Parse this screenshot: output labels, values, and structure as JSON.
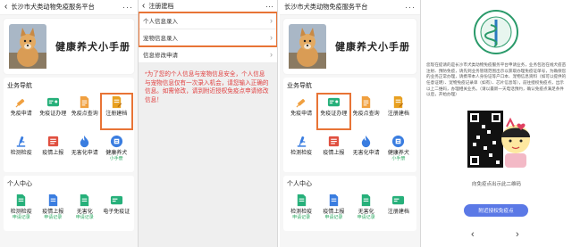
{
  "panel1": {
    "title": "长沙市犬类动物免疫服务平台",
    "hero_title": "健康养犬小手册",
    "business_nav": "业务导航",
    "items": [
      {
        "label": "免疫申请",
        "icon": "syringe-icon",
        "color": "#f0a040"
      },
      {
        "label": "免疫证办理",
        "icon": "id-card-icon",
        "color": "#26b07a"
      },
      {
        "label": "免疫点查询",
        "icon": "document-icon",
        "color": "#f0a040"
      },
      {
        "label": "注册建档",
        "icon": "edit-doc-icon",
        "color": "#e8a020"
      },
      {
        "label": "检测检疫",
        "icon": "microscope-icon",
        "color": "#3a7de0"
      },
      {
        "label": "疫情上报",
        "icon": "report-icon",
        "color": "#e05040"
      },
      {
        "label": "无害化申请",
        "icon": "flame-icon",
        "color": "#3a7de0"
      },
      {
        "label": "健康养犬",
        "sub": "小手册",
        "icon": "book-icon",
        "color": "#3a7de0"
      }
    ],
    "personal_center": "个人中心",
    "personal_items": [
      {
        "label": "检测检疫",
        "sub": "申请记录",
        "icon": "doc-blue-icon",
        "color": "#26b07a"
      },
      {
        "label": "疫情上报",
        "sub": "申请记录",
        "icon": "doc-blue-icon",
        "color": "#3a7de0"
      },
      {
        "label": "无害化",
        "sub": "申请记录",
        "icon": "doc-green-icon",
        "color": "#26b07a"
      },
      {
        "label": "电子免疫证",
        "icon": "card-icon",
        "color": "#26b07a"
      }
    ]
  },
  "panel2": {
    "title": "注册建档",
    "items": [
      "个人信息录入",
      "宠物信息录入",
      "信息修改申请"
    ],
    "notice": "*为了您的个人信息与宠物信息安全，个人信息与宠物信息仅有一次录入机会，请您输入正确的信息。如需修改，请到附近授权免疫点申请修改信息！"
  },
  "panel3": {
    "title": "长沙市犬类动物免疫服务平台",
    "hero_title": "健康养犬小手册",
    "business_nav": "业务导航",
    "items": [
      {
        "label": "免疫申请",
        "icon": "syringe-icon",
        "color": "#f0a040"
      },
      {
        "label": "免疫证办理",
        "icon": "id-card-icon",
        "color": "#26b07a"
      },
      {
        "label": "免疫点查询",
        "icon": "document-icon",
        "color": "#f0a040"
      },
      {
        "label": "注册建档",
        "icon": "edit-doc-icon",
        "color": "#e8a020"
      },
      {
        "label": "检测检疫",
        "icon": "microscope-icon",
        "color": "#3a7de0"
      },
      {
        "label": "疫情上报",
        "icon": "report-icon",
        "color": "#e05040"
      },
      {
        "label": "无害化申请",
        "icon": "flame-icon",
        "color": "#3a7de0"
      },
      {
        "label": "健康养犬",
        "sub": "小手册",
        "icon": "book-icon",
        "color": "#3a7de0"
      }
    ],
    "personal_center": "个人中心",
    "personal_items": [
      {
        "label": "检测检疫",
        "sub": "申请记录",
        "icon": "doc-blue-icon",
        "color": "#26b07a"
      },
      {
        "label": "疫情上报",
        "sub": "申请记录",
        "icon": "doc-blue-icon",
        "color": "#3a7de0"
      },
      {
        "label": "无害化",
        "sub": "申请记录",
        "icon": "doc-green-icon",
        "color": "#26b07a"
      },
      {
        "label": "注册建档",
        "icon": "card-icon",
        "color": "#26b07a"
      }
    ]
  },
  "panel4": {
    "description": "您现在提请的是长沙市犬类动物免疫服务平台申请业务，业务包括在线犬疫苗注射、预防免疫，请先到业务管辖范围出示以获取办理免疫证单号，为确保您的业务正常办理，请携带本人身份证等户口本、宠物信息资料（如可以提供的任意证明）、宠物免疫记录单（如有）、芯片信息等），前往授权免疫点，出示以上二维码，办理相关业务。（请以最新一天电话预约，确认免疫点满足条件以后，开始办理）",
    "qr_caption": "向免疫点出示此二维码",
    "button": "附近授权免疫点",
    "nav_prev": "‹",
    "nav_next": "›"
  }
}
